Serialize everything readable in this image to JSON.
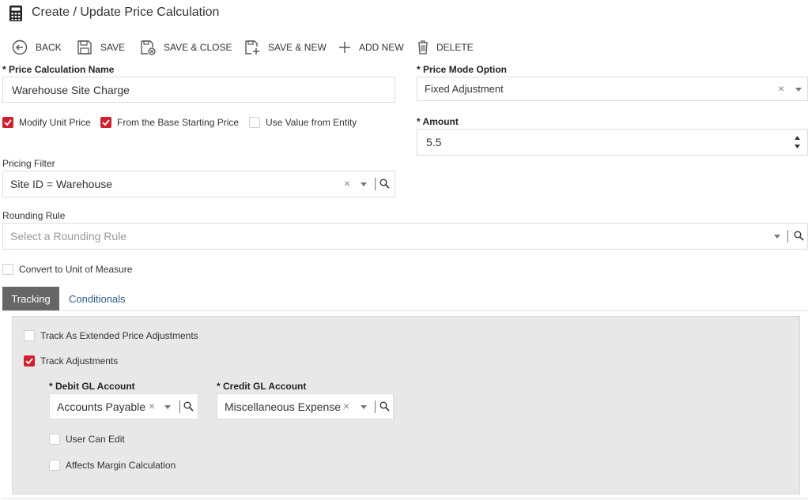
{
  "window": {
    "title": "Create / Update Price Calculation",
    "title_icon": "calculator-icon"
  },
  "toolbar": {
    "back_label": "BACK",
    "save_label": "SAVE",
    "save_close_label": "SAVE & CLOSE",
    "save_new_label": "SAVE & NEW",
    "add_new_label": "ADD NEW",
    "delete_label": "DELETE"
  },
  "form": {
    "name_label": "* Price Calculation Name",
    "name_value": "Warehouse Site Charge",
    "mode_label": "* Price Mode Option",
    "mode_value": "Fixed Adjustment",
    "modify_unit_price_label": "Modify Unit Price",
    "modify_unit_price_checked": true,
    "from_base_label": "From the Base Starting Price",
    "from_base_checked": true,
    "use_entity_label": "Use Value from Entity",
    "use_entity_checked": false,
    "amount_label": "* Amount",
    "amount_value": "5.5",
    "pricing_filter_label": "Pricing Filter",
    "pricing_filter_value": "Site ID = Warehouse",
    "rounding_rule_label": "Rounding Rule",
    "rounding_rule_placeholder": "Select a Rounding Rule",
    "convert_uom_label": "Convert to Unit of Measure",
    "convert_uom_checked": false
  },
  "tabs": [
    {
      "label": "Tracking",
      "active": true
    },
    {
      "label": "Conditionals",
      "active": false
    }
  ],
  "tracking": {
    "track_extended_label": "Track As Extended Price Adjustments",
    "track_extended_checked": false,
    "track_adjustments_label": "Track Adjustments",
    "track_adjustments_checked": true,
    "debit_label": "* Debit GL Account",
    "debit_value": "Accounts Payable",
    "credit_label": "* Credit GL Account",
    "credit_value": "Miscellaneous Expense",
    "user_can_edit_label": "User Can Edit",
    "user_can_edit_checked": false,
    "affects_margin_label": "Affects Margin Calculation",
    "affects_margin_checked": false
  },
  "colors": {
    "accent": "#d0202e",
    "tab_active_bg": "#666666",
    "link": "#2d5b8a",
    "panel_bg": "#e8e8e8"
  }
}
